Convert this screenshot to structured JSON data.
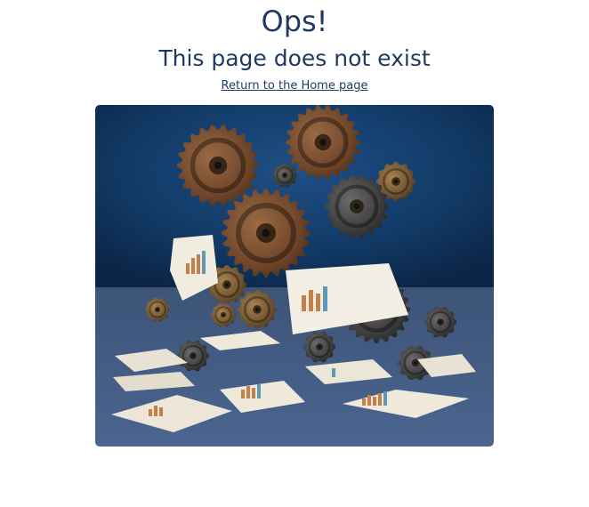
{
  "error": {
    "title": "Ops!",
    "subtitle": "This page does not exist",
    "home_link_label": "Return to the Home page"
  },
  "colors": {
    "text": "#1f3a5f",
    "background": "#ffffff"
  }
}
